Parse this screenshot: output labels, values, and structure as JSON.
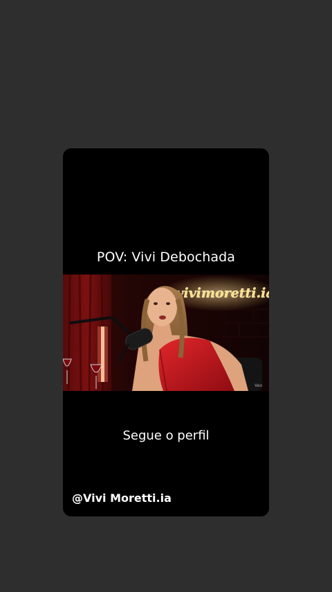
{
  "story": {
    "caption_top": "POV: Vivi Debochada",
    "caption_mid": "Segue o perfil",
    "profile_handle": "@Vivi Moretti.ia",
    "neon_sign": "@vivimoretti.ia",
    "watermark": "Veo"
  },
  "colors": {
    "page_background": "#2e2e2e",
    "card_background": "#000000",
    "neon_yellow": "#ffd66a",
    "dress_red": "#c0131a"
  }
}
